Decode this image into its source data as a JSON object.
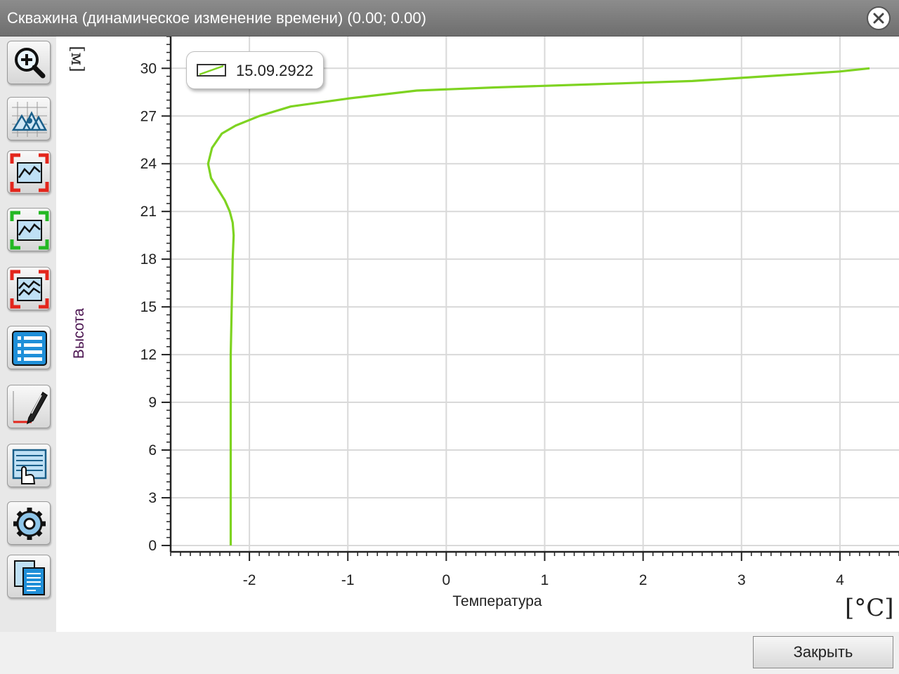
{
  "window": {
    "title": "Скважина (динамическое изменение времени) (0.00; 0.00)",
    "close_icon": "close-icon"
  },
  "toolbar": {
    "icons": [
      "zoom-in-icon",
      "chart-layers-icon",
      "fit-red-icon",
      "fit-green-icon",
      "multi-series-icon",
      "list-icon",
      "edit-pen-icon",
      "table-hand-icon",
      "settings-icon",
      "copy-icon"
    ]
  },
  "footer": {
    "close_label": "Закрыть"
  },
  "colors": {
    "series": "#7ed321",
    "grid": "#d9d9d9",
    "axis": "#222222"
  },
  "chart_data": {
    "type": "line",
    "xlabel": "Температура",
    "ylabel": "Высота",
    "x_unit": "[°C]",
    "y_unit": "[м]",
    "xlim": [
      -2.8,
      4.6
    ],
    "ylim": [
      -0.4,
      32
    ],
    "x_ticks": [
      -2,
      -1,
      0,
      1,
      2,
      3,
      4
    ],
    "y_ticks": [
      0,
      3,
      6,
      9,
      12,
      15,
      18,
      21,
      24,
      27,
      30
    ],
    "grid": true,
    "legend_position": "top-left",
    "series": [
      {
        "name": "15.09.2922",
        "color": "#7ed321",
        "x": [
          -2.19,
          -2.19,
          -2.19,
          -2.19,
          -2.19,
          -2.18,
          -2.17,
          -2.16,
          -2.17,
          -2.2,
          -2.25,
          -2.32,
          -2.39,
          -2.42,
          -2.38,
          -2.28,
          -2.14,
          -1.9,
          -1.58,
          -1.0,
          -0.3,
          0.5,
          1.5,
          2.5,
          3.0,
          3.5,
          4.0,
          4.3
        ],
        "y": [
          0,
          3,
          6,
          9,
          12,
          15,
          18,
          19.5,
          20.3,
          21,
          21.7,
          22.4,
          23.1,
          24,
          25,
          25.9,
          26.4,
          27,
          27.6,
          28.1,
          28.6,
          28.8,
          29,
          29.2,
          29.4,
          29.6,
          29.8,
          30
        ]
      }
    ]
  }
}
